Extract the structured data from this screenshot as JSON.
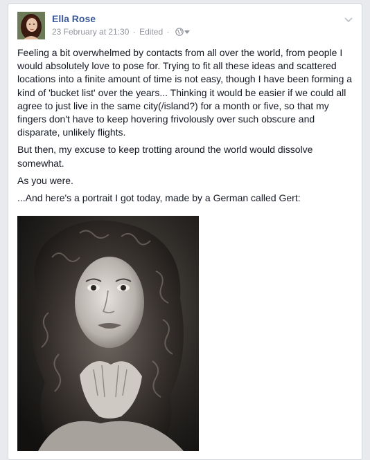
{
  "post": {
    "author": "Ella Rose",
    "timestamp": "23 February at 21:30",
    "edited_label": "Edited",
    "separator": "·",
    "audience_icon": "globe-icon",
    "menu_icon": "chevron-down-icon",
    "paragraphs": [
      "Feeling a bit overwhelmed by contacts from all over the world, from people I would absolutely love to pose for. Trying to fit all these ideas and scattered locations into a finite amount of time is not easy, though I have been forming a kind of 'bucket list' over the years... Thinking it would be easier if we could all agree to just live in the same city(/island?) for a month or five, so that my fingers don't have to keep hovering frivolously over such obscure and disparate, unlikely flights.",
      "But then, my excuse to keep trotting around the world would dissolve somewhat.",
      "As you were.",
      "...And here's a portrait I got today, made by a German called Gert:"
    ]
  },
  "colors": {
    "author_link": "#3b5998",
    "meta_text": "#90949c",
    "body_text": "#141823",
    "page_bg": "#e9eaed"
  }
}
